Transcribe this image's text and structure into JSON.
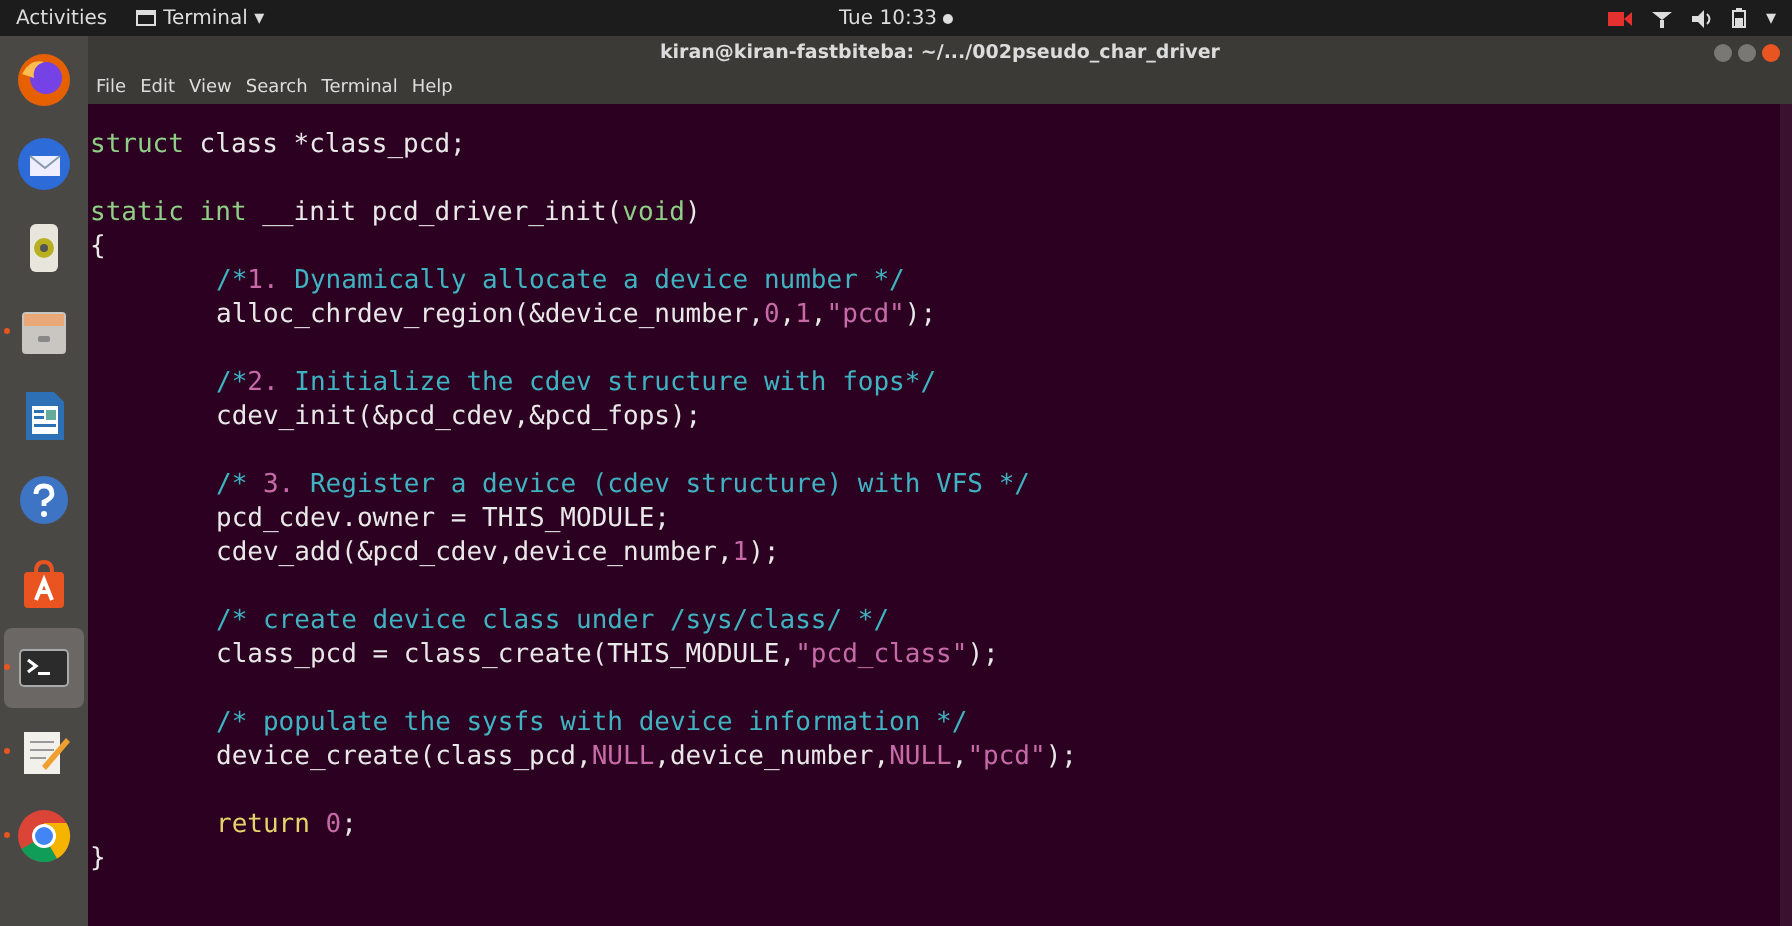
{
  "top_bar": {
    "activities": "Activities",
    "app_menu": "Terminal ▾",
    "clock": "Tue 10:33",
    "recording": true,
    "caret": "▾"
  },
  "dock": {
    "items": [
      {
        "kind": "firefox",
        "running": false,
        "selected": false
      },
      {
        "kind": "mail",
        "running": false,
        "selected": false
      },
      {
        "kind": "speaker",
        "running": false,
        "selected": false
      },
      {
        "kind": "files",
        "running": true,
        "selected": false
      },
      {
        "kind": "writer",
        "running": false,
        "selected": false
      },
      {
        "kind": "help",
        "running": false,
        "selected": false
      },
      {
        "kind": "software",
        "running": false,
        "selected": false
      },
      {
        "kind": "terminal",
        "running": true,
        "selected": true
      },
      {
        "kind": "editor",
        "running": true,
        "selected": false
      },
      {
        "kind": "chrome",
        "running": true,
        "selected": false
      }
    ]
  },
  "window": {
    "title": "kiran@kiran-fastbiteba: ~/.../002pseudo_char_driver",
    "menu": [
      "File",
      "Edit",
      "View",
      "Search",
      "Terminal",
      "Help"
    ]
  },
  "code": [
    {
      "kind": "code",
      "indented": false,
      "tokens": [
        {
          "kind": "type",
          "text": "struct"
        },
        {
          "kind": "plain",
          "text": " class *class_pcd;"
        }
      ]
    },
    {
      "kind": "blank"
    },
    {
      "kind": "code",
      "indented": false,
      "tokens": [
        {
          "kind": "type",
          "text": "static int"
        },
        {
          "kind": "plain",
          "text": " __init pcd_driver_init("
        },
        {
          "kind": "type",
          "text": "void"
        },
        {
          "kind": "plain",
          "text": ")"
        }
      ]
    },
    {
      "kind": "code",
      "indented": false,
      "tokens": [
        {
          "kind": "plain",
          "text": "{"
        }
      ]
    },
    {
      "kind": "code",
      "indented": true,
      "tokens": [
        {
          "kind": "comment",
          "text": "/*"
        },
        {
          "kind": "number",
          "text": "1."
        },
        {
          "kind": "comment",
          "text": " Dynamically allocate a device number */"
        }
      ]
    },
    {
      "kind": "code",
      "indented": true,
      "tokens": [
        {
          "kind": "plain",
          "text": "alloc_chrdev_region(&device_number,"
        },
        {
          "kind": "number",
          "text": "0"
        },
        {
          "kind": "plain",
          "text": ","
        },
        {
          "kind": "number",
          "text": "1"
        },
        {
          "kind": "plain",
          "text": ","
        },
        {
          "kind": "string",
          "text": "\"pcd\""
        },
        {
          "kind": "plain",
          "text": ");"
        }
      ]
    },
    {
      "kind": "blank"
    },
    {
      "kind": "code",
      "indented": true,
      "tokens": [
        {
          "kind": "comment",
          "text": "/*"
        },
        {
          "kind": "number",
          "text": "2."
        },
        {
          "kind": "comment",
          "text": " Initialize the cdev structure with fops*/"
        }
      ]
    },
    {
      "kind": "code",
      "indented": true,
      "tokens": [
        {
          "kind": "plain",
          "text": "cdev_init(&pcd_cdev,&pcd_fops);"
        }
      ]
    },
    {
      "kind": "blank"
    },
    {
      "kind": "code",
      "indented": true,
      "tokens": [
        {
          "kind": "comment",
          "text": "/* "
        },
        {
          "kind": "number",
          "text": "3."
        },
        {
          "kind": "comment",
          "text": " Register a device (cdev structure) with VFS */"
        }
      ]
    },
    {
      "kind": "code",
      "indented": true,
      "tokens": [
        {
          "kind": "plain",
          "text": "pcd_cdev.owner = THIS_MODULE;"
        }
      ]
    },
    {
      "kind": "code",
      "indented": true,
      "tokens": [
        {
          "kind": "plain",
          "text": "cdev_add(&pcd_cdev,device_number,"
        },
        {
          "kind": "number",
          "text": "1"
        },
        {
          "kind": "plain",
          "text": ");"
        }
      ]
    },
    {
      "kind": "blank"
    },
    {
      "kind": "code",
      "indented": true,
      "tokens": [
        {
          "kind": "comment",
          "text": "/* create device class under /sys/class/ */"
        }
      ]
    },
    {
      "kind": "code",
      "indented": true,
      "tokens": [
        {
          "kind": "plain",
          "text": "class_pcd = class_create(THIS_MODULE,"
        },
        {
          "kind": "string",
          "text": "\"pcd_class\""
        },
        {
          "kind": "plain",
          "text": ");"
        }
      ]
    },
    {
      "kind": "blank"
    },
    {
      "kind": "code",
      "indented": true,
      "tokens": [
        {
          "kind": "comment",
          "text": "/* populate the sysfs with device information */"
        }
      ]
    },
    {
      "kind": "code",
      "indented": true,
      "tokens": [
        {
          "kind": "plain",
          "text": "device_create(class_pcd,"
        },
        {
          "kind": "number",
          "text": "NULL"
        },
        {
          "kind": "plain",
          "text": ",device_number,"
        },
        {
          "kind": "number",
          "text": "NULL"
        },
        {
          "kind": "plain",
          "text": ","
        },
        {
          "kind": "string",
          "text": "\"pcd\""
        },
        {
          "kind": "plain",
          "text": ");"
        }
      ]
    },
    {
      "kind": "blank"
    },
    {
      "kind": "code",
      "indented": true,
      "tokens": [
        {
          "kind": "keyword",
          "text": "return"
        },
        {
          "kind": "number",
          "text": " 0"
        },
        {
          "kind": "plain",
          "text": ";"
        }
      ]
    },
    {
      "kind": "code",
      "indented": false,
      "tokens": [
        {
          "kind": "plain",
          "text": "}"
        }
      ]
    }
  ]
}
